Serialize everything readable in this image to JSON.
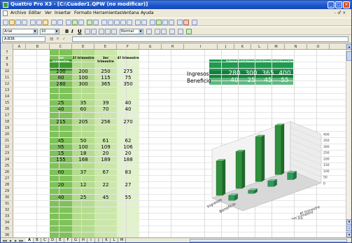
{
  "window": {
    "title": "Quattro Pro X3 - [C:\\Cuader1.QPW (no modificar)]",
    "controls": {
      "minimize": "_",
      "maximize": "□",
      "close": "×"
    }
  },
  "menu": {
    "items": [
      "Archivo",
      "Editar",
      "Ver",
      "Insertar",
      "Formato",
      "Herramientas",
      "Ventana",
      "Ayuda"
    ],
    "right_controls": "- ♂ ×"
  },
  "toolbar2": {
    "font": "Arial",
    "size": "10",
    "bold": "B",
    "italic": "I",
    "underline": "U",
    "style": "Normal"
  },
  "formula_bar": {
    "cell_ref": "A:B36",
    "formula": ""
  },
  "columns": [
    "A",
    "B",
    "C",
    "D",
    "E",
    "F",
    "G",
    "H",
    "I",
    "J",
    "K",
    "L",
    "M",
    "N",
    "O"
  ],
  "rows": [
    "7",
    "8",
    "9",
    "10",
    "11",
    "12",
    "13",
    "14",
    "15",
    "16",
    "17",
    "18",
    "19",
    "20",
    "21",
    "22",
    "23",
    "24",
    "25",
    "26",
    "27",
    "28",
    "29",
    "30",
    "31",
    "32",
    "33",
    "34",
    "35",
    "36"
  ],
  "table": {
    "header": [
      "1er trimestre",
      "2º trimestre",
      "3er trimestre",
      "4º trimestre"
    ],
    "rows": [
      {
        "r": "10",
        "v": [
          "200",
          "200",
          "250",
          "275"
        ]
      },
      {
        "r": "11",
        "v": [
          "80",
          "100",
          "115",
          "75"
        ]
      },
      {
        "r": "12",
        "v": [
          "280",
          "300",
          "365",
          "350"
        ]
      },
      {
        "r": "15",
        "v": [
          "25",
          "35",
          "39",
          "40"
        ]
      },
      {
        "r": "16",
        "v": [
          "40",
          "60",
          "70",
          "40"
        ]
      },
      {
        "r": "18",
        "v": [
          "215",
          "205",
          "256",
          "270"
        ]
      },
      {
        "r": "21",
        "v": [
          "45",
          "50",
          "61",
          "62"
        ]
      },
      {
        "r": "22",
        "v": [
          "95",
          "100",
          "109",
          "106"
        ]
      },
      {
        "r": "23",
        "v": [
          "15",
          "18",
          "20",
          "20"
        ]
      },
      {
        "r": "24",
        "v": [
          "155",
          "168",
          "189",
          "188"
        ]
      },
      {
        "r": "26",
        "v": [
          "60",
          "37",
          "67",
          "83"
        ]
      },
      {
        "r": "28",
        "v": [
          "20",
          "12",
          "22",
          "27"
        ]
      },
      {
        "r": "30",
        "v": [
          "40",
          "25",
          "45",
          "55"
        ]
      }
    ]
  },
  "summary": {
    "header": [
      "1er trimestre",
      "2º trimestre",
      "3er trimestre",
      "4º trimestre"
    ],
    "rows": [
      {
        "label": "Ingresos",
        "v": [
          "280",
          "300",
          "365",
          "400"
        ]
      },
      {
        "label": "Beneficio",
        "v": [
          "40",
          "25",
          "45",
          "55"
        ]
      }
    ]
  },
  "chart_data": {
    "type": "bar",
    "title": "",
    "categories": [
      "1er trimestre",
      "2º trimestre",
      "3er trimestre",
      "4º trimestre"
    ],
    "series": [
      {
        "name": "Ingresos",
        "values": [
          280,
          300,
          365,
          400
        ]
      },
      {
        "name": "Beneficio",
        "values": [
          40,
          25,
          45,
          55
        ]
      }
    ],
    "ylim": [
      0,
      400
    ],
    "yticks": [
      "0",
      "50",
      "100",
      "150",
      "200",
      "250",
      "300",
      "350",
      "400"
    ],
    "colors": {
      "Ingresos": "#2e8b3e",
      "Beneficio": "#2e8b5a"
    }
  },
  "sheet_tabs": [
    "A",
    "B",
    "C",
    "D",
    "E",
    "F",
    "G",
    "H",
    "I",
    "J",
    "K",
    "L",
    "M"
  ],
  "colors": {
    "accent": "#1c55c9",
    "green_dark": "#2f8f2f",
    "green_light": "#c6e2a8",
    "green_mid": "#7cbf5a"
  }
}
